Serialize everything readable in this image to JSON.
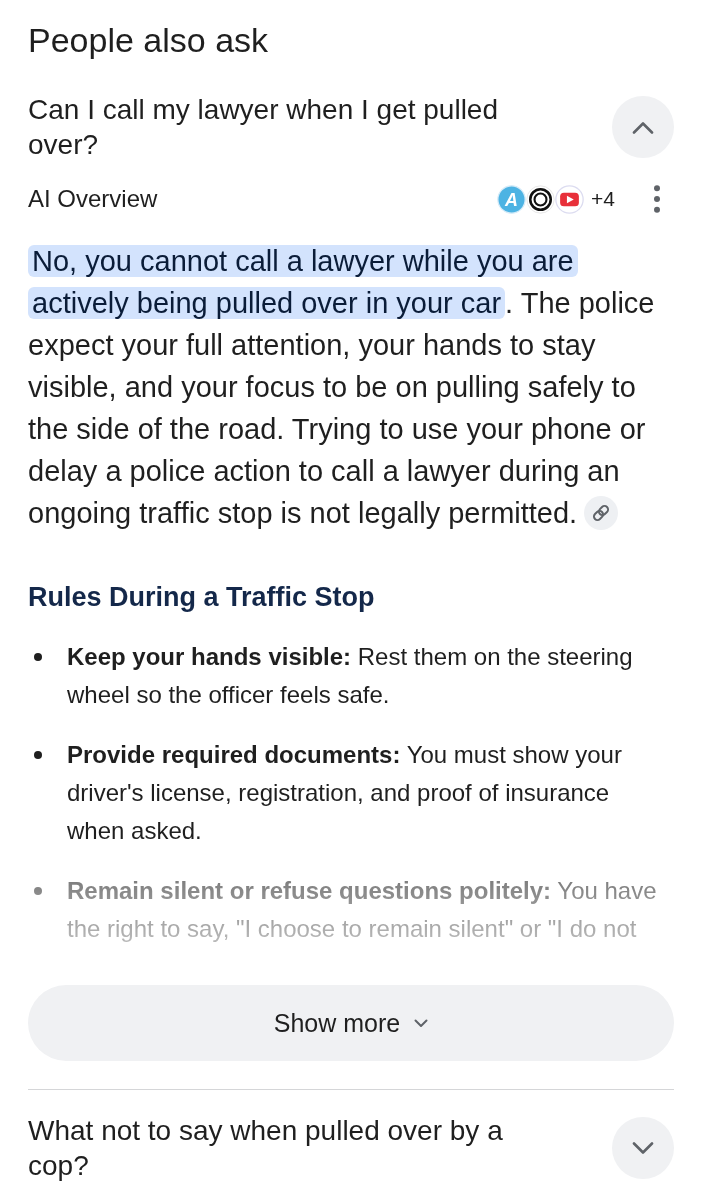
{
  "title": "People also ask",
  "questions": [
    {
      "question": "Can I call my lawyer when I get pulled over?",
      "expanded": true,
      "answer": {
        "label": "AI Overview",
        "sources": [
          {
            "kind": "letter",
            "text": "A"
          },
          {
            "kind": "rings"
          },
          {
            "kind": "play"
          }
        ],
        "more_sources": "+4",
        "highlighted": "No, you cannot call a lawyer while you are actively being pulled over in your car",
        "text": ". The police expect your full attention, your hands to stay visible, and your focus to be on pulling safely to the side of the road. Trying to use your phone or delay a police action to call a lawyer during an ongoing traffic stop is not legally permitted.",
        "section_title": "Rules During a Traffic Stop",
        "bullets": [
          {
            "text": "**Keep your hands visible:** Rest them on the steering wheel so the officer feels safe.",
            "faded": false
          },
          {
            "text": "**Provide required documents:** You must show your driver's license, registration, and proof of insurance when asked.",
            "faded": false
          },
          {
            "text": "**Remain silent or refuse questions politely:** You have the right to say, \"I choose to remain silent\" or \"I do not",
            "faded": true
          }
        ],
        "show_more": "Show more"
      }
    },
    {
      "question": "What not to say when pulled over by a cop?",
      "expanded": false
    }
  ]
}
